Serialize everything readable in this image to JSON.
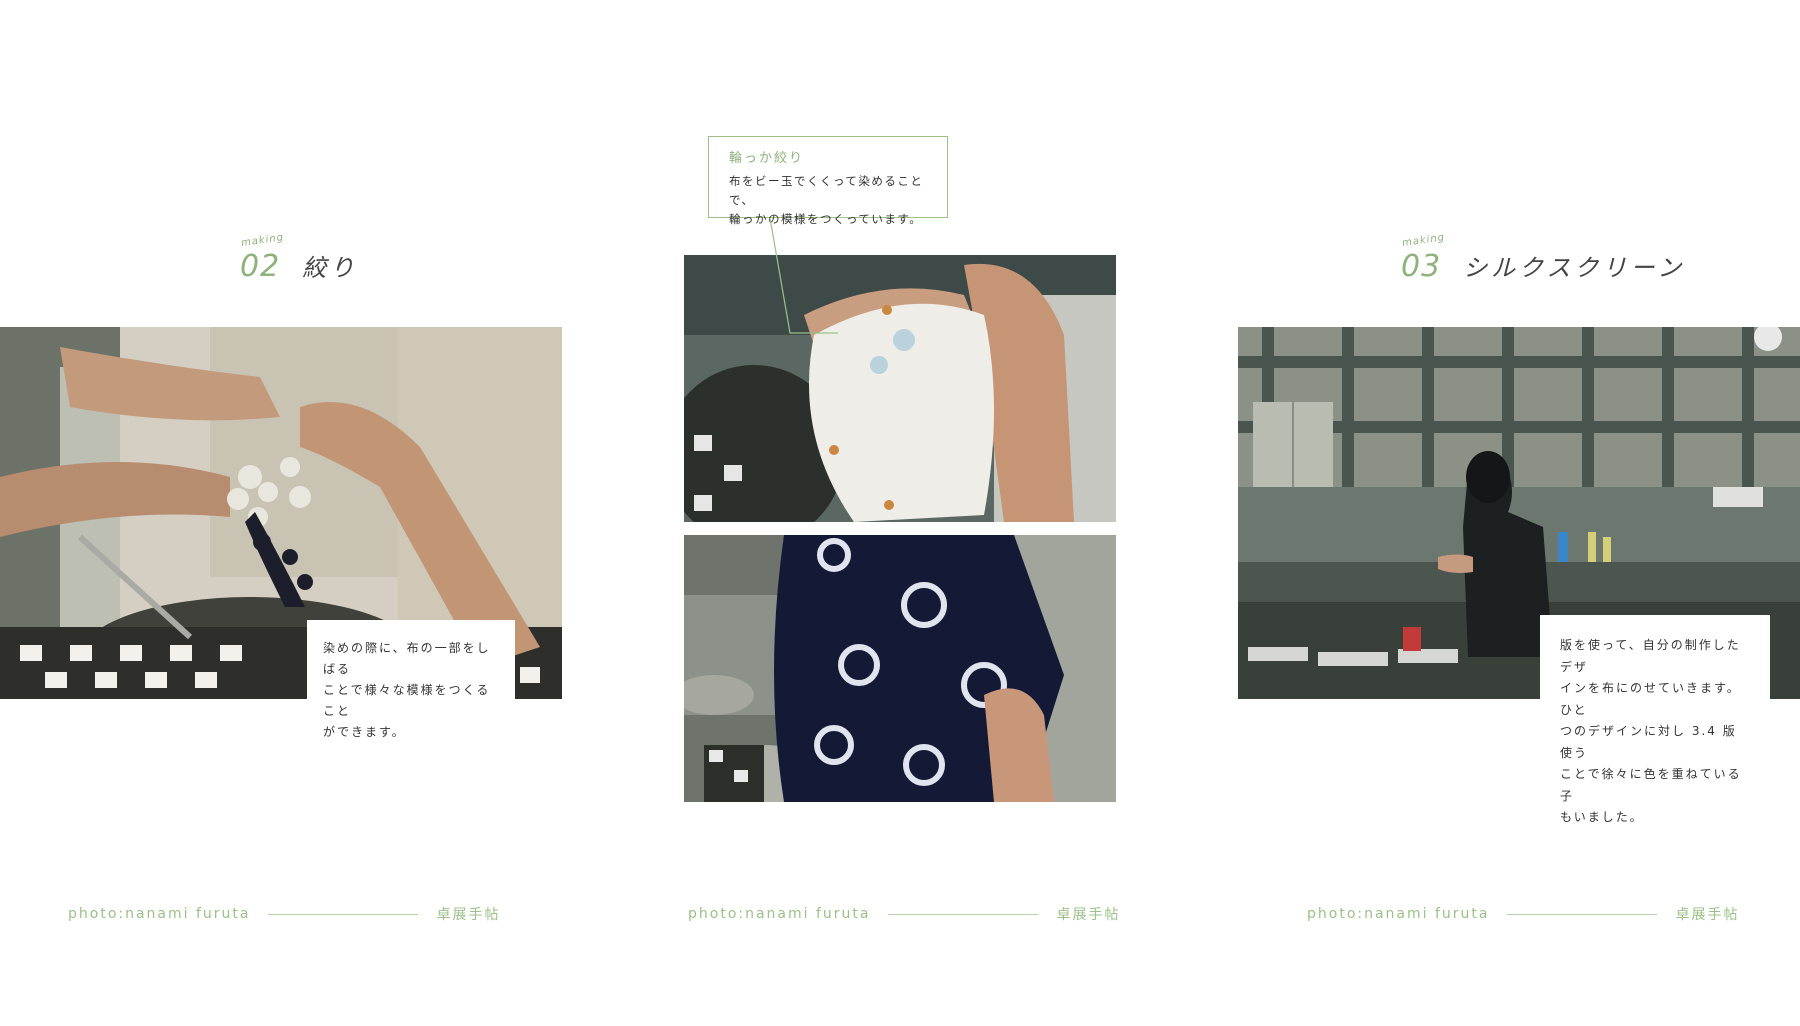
{
  "sections": [
    {
      "making_label": "making",
      "number": "02",
      "title": "絞り"
    },
    {
      "making_label": "making",
      "number": "03",
      "title": "シルクスクリーン"
    }
  ],
  "callout": {
    "title": "輪っか絞り",
    "lines": [
      "布をビー玉でくくって染めることで、",
      "輪っかの模様をつくっています。"
    ]
  },
  "captions": {
    "shibori": [
      "染めの際に、布の一部をしばる",
      "ことで様々な模様をつくること",
      "ができます。"
    ],
    "silkscreen": [
      "版を使って、自分の制作したデザ",
      "インを布にのせていきます。ひと",
      "つのデザインに対し 3.4 版使う",
      "ことで徐々に色を重ねている子",
      "もいました。"
    ]
  },
  "footers": [
    {
      "credit": "photo:nanami furuta",
      "brand": "卓展手帖"
    },
    {
      "credit": "photo:nanami furuta",
      "brand": "卓展手帖"
    },
    {
      "credit": "photo:nanami furuta",
      "brand": "卓展手帖"
    }
  ],
  "colors": {
    "accent": "#8fb27d",
    "text": "#333333",
    "background": "#ffffff"
  }
}
